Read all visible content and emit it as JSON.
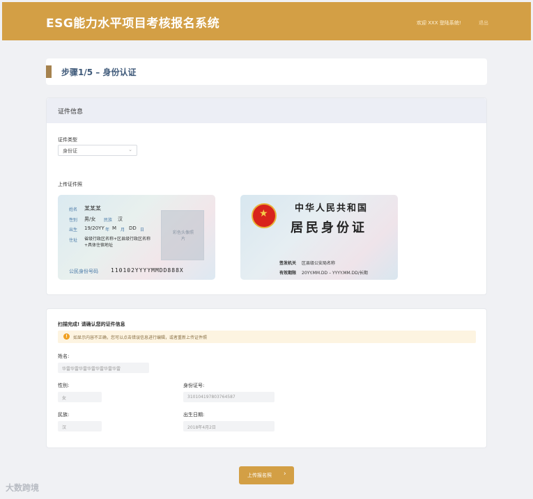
{
  "header": {
    "title": "ESG能力水平项目考核报名系统",
    "welcome": "欢迎 XXX 登陆系统!",
    "logout": "退出"
  },
  "step": {
    "title": "步骤1/5 – 身份认证"
  },
  "cert": {
    "section_title": "证件信息",
    "type_label": "证件类型",
    "type_value": "身份证",
    "upload_label": "上传证件照",
    "front": {
      "name_label": "姓名",
      "name_value": "某某某",
      "gender_label": "性别",
      "gender_value": "男/女",
      "ethnic_label": "民族",
      "ethnic_value": "汉",
      "birth_label": "出生",
      "birth_year": "19/20YY",
      "birth_y": "年",
      "birth_month": "M",
      "birth_m": "月",
      "birth_day": "DD",
      "birth_d": "日",
      "address_label": "住址",
      "address_value": "省级行政区名称+区县级行政区名称+具体住宿地址",
      "photo_placeholder": "彩色头像照片",
      "id_label": "公民身份号码",
      "id_value": "110102YYYYMMDD888X"
    },
    "back": {
      "country": "中华人民共和国",
      "card_name": "居民身份证",
      "authority_label": "签发机关",
      "authority_value": "区县级公安局名称",
      "validity_label": "有效期限",
      "validity_value": "20YY.MM.DD – YYYY.MM.DD/长期"
    }
  },
  "scan": {
    "title": "扫描完成! 请确认您的证件信息",
    "notice": "如显示内容不正确，您可以点击错误信息进行编辑，或者重新上传证件照",
    "name_label": "姓名:",
    "name_value": "华雷华雷华雷华雷华雷华雷华雷",
    "gender_label": "性别:",
    "gender_value": "女",
    "id_label": "身份证号:",
    "id_value": "310104197803764587",
    "ethnic_label": "民族:",
    "ethnic_value": "汉",
    "birth_label": "出生日期:",
    "birth_value": "2018年4月2日"
  },
  "submit": {
    "label": "上传报名照",
    "arrow": "›"
  },
  "watermark": "大数跨境",
  "colors": {
    "brand": "#d39f45",
    "step_bar": "#a5824e",
    "step_text": "#3f5a7a"
  },
  "icons": {
    "warning": "warning-icon",
    "chevron": "chevron-down-icon",
    "emblem": "national-emblem-icon"
  }
}
